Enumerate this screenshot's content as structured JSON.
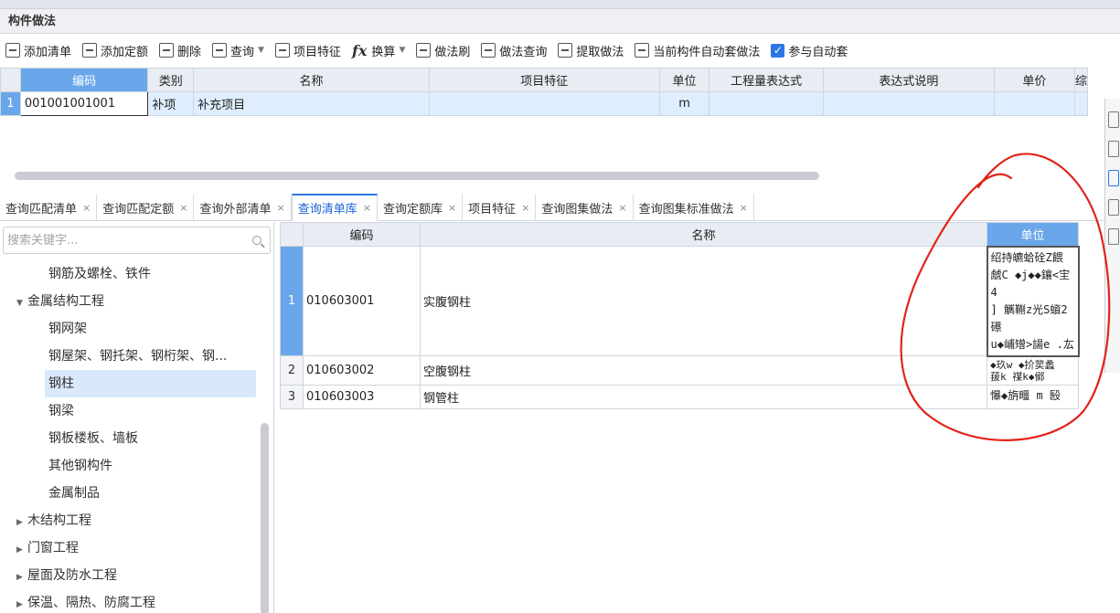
{
  "panel": {
    "title": "构件做法"
  },
  "toolbar": {
    "add_bill": "添加清单",
    "add_quota": "添加定额",
    "delete": "删除",
    "query": "查询",
    "item_feature": "项目特征",
    "convert": "换算",
    "method_brush": "做法刷",
    "method_query": "做法查询",
    "extract_method": "提取做法",
    "auto_method": "当前构件自动套做法",
    "join_auto": "参与自动套"
  },
  "top_grid": {
    "headers": [
      "编码",
      "类别",
      "名称",
      "项目特征",
      "单位",
      "工程量表达式",
      "表达式说明",
      "单价",
      "综"
    ],
    "rows": [
      {
        "num": "1",
        "code": "001001001001",
        "type": "补项",
        "name": "补充项目",
        "feature": "",
        "unit": "m",
        "expr": "",
        "expr_desc": "",
        "price": ""
      }
    ]
  },
  "tabs": [
    {
      "label": "查询匹配清单"
    },
    {
      "label": "查询匹配定额"
    },
    {
      "label": "查询外部清单"
    },
    {
      "label": "查询清单库",
      "active": true
    },
    {
      "label": "查询定额库"
    },
    {
      "label": "项目特征"
    },
    {
      "label": "查询图集做法"
    },
    {
      "label": "查询图集标准做法"
    }
  ],
  "tab_close": "×",
  "search": {
    "placeholder": "搜索关键字..."
  },
  "tree": [
    {
      "label": "钢筋及螺栓、铁件",
      "level": 2
    },
    {
      "label": "金属结构工程",
      "level": 1,
      "expanded": true
    },
    {
      "label": "钢网架",
      "level": 2
    },
    {
      "label": "钢屋架、钢托架、钢桁架、钢...",
      "level": 2
    },
    {
      "label": "钢柱",
      "level": 2,
      "selected": true
    },
    {
      "label": "钢梁",
      "level": 2
    },
    {
      "label": "钢板楼板、墙板",
      "level": 2
    },
    {
      "label": "其他钢构件",
      "level": 2
    },
    {
      "label": "金属制品",
      "level": 2
    },
    {
      "label": "木结构工程",
      "level": 1,
      "expanded": false
    },
    {
      "label": "门窗工程",
      "level": 1,
      "expanded": false
    },
    {
      "label": "屋面及防水工程",
      "level": 1,
      "expanded": false
    },
    {
      "label": "保温、隔热、防腐工程",
      "level": 1,
      "expanded": false
    }
  ],
  "bill_grid": {
    "headers": [
      "编码",
      "名称",
      "单位"
    ],
    "rows": [
      {
        "num": "1",
        "code": "010603001",
        "name": "实腹钢柱",
        "unit": "绍持皫蛤硂Z餵\n虤C  ◆j◆◆鑲<宔4\n] 觽鞩z光S蠀2礤\nu◆峬矰>諹e  .厷"
      },
      {
        "num": "2",
        "code": "010603002",
        "name": "空腹钢柱",
        "unit": "◆玖w   ◆扴荬蠡\n菝k  禖k◆鄇"
      },
      {
        "num": "3",
        "code": "010603003",
        "name": "钢管柱",
        "unit": "懪◆旃疅  m  殹"
      }
    ]
  }
}
